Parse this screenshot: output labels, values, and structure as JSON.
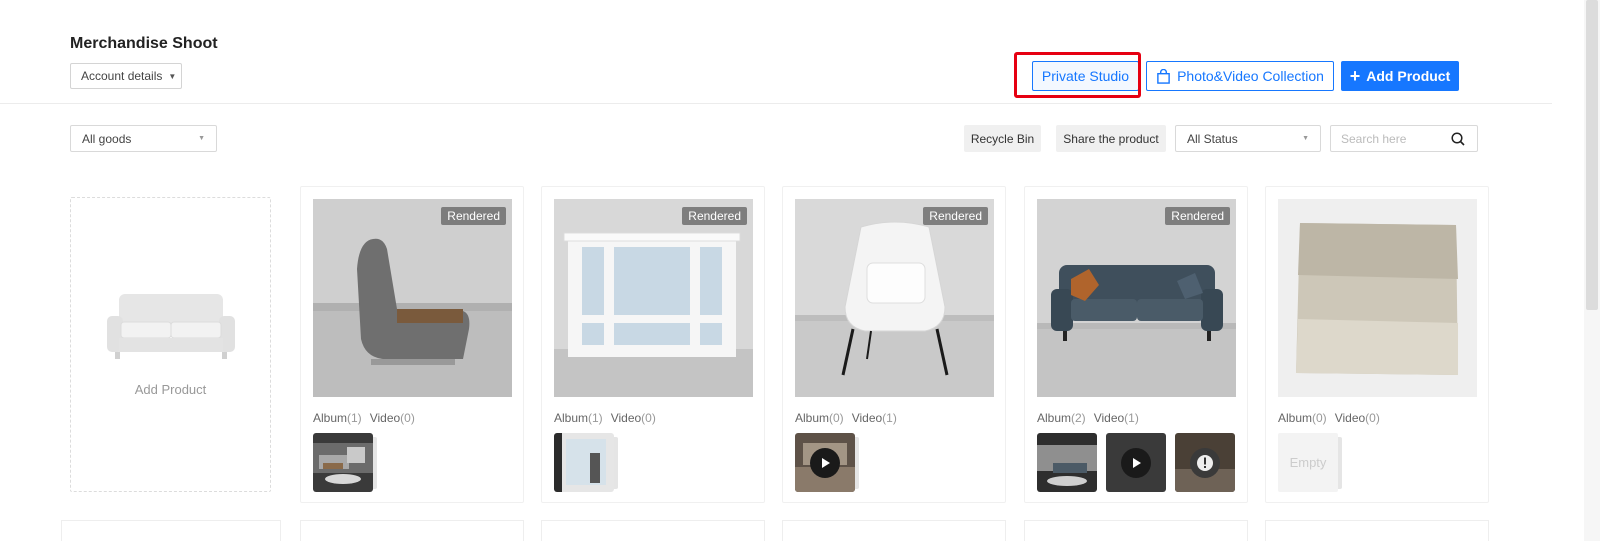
{
  "header": {
    "title": "Merchandise Shoot",
    "account_label": "Account details",
    "private_studio_label": "Private Studio",
    "collection_label": "Photo&Video Collection",
    "add_product_label": "Add Product"
  },
  "toolbar": {
    "goods_filter": "All goods",
    "recycle_label": "Recycle Bin",
    "share_label": "Share the product",
    "status_filter": "All Status",
    "search_placeholder": "Search here"
  },
  "add_card": {
    "label": "Add Product"
  },
  "cards": [
    {
      "badge": "Rendered",
      "album_label": "Album",
      "album_count": "(1)",
      "video_label": "Video",
      "video_count": "(0)"
    },
    {
      "badge": "Rendered",
      "album_label": "Album",
      "album_count": "(1)",
      "video_label": "Video",
      "video_count": "(0)"
    },
    {
      "badge": "Rendered",
      "album_label": "Album",
      "album_count": "(0)",
      "video_label": "Video",
      "video_count": "(1)"
    },
    {
      "badge": "Rendered",
      "album_label": "Album",
      "album_count": "(2)",
      "video_label": "Video",
      "video_count": "(1)"
    },
    {
      "badge": "",
      "album_label": "Album",
      "album_count": "(0)",
      "video_label": "Video",
      "video_count": "(0)",
      "empty_label": "Empty"
    }
  ],
  "colors": {
    "accent": "#1677ff",
    "highlight": "#e60012",
    "badge_bg": "#6e6e6e"
  }
}
